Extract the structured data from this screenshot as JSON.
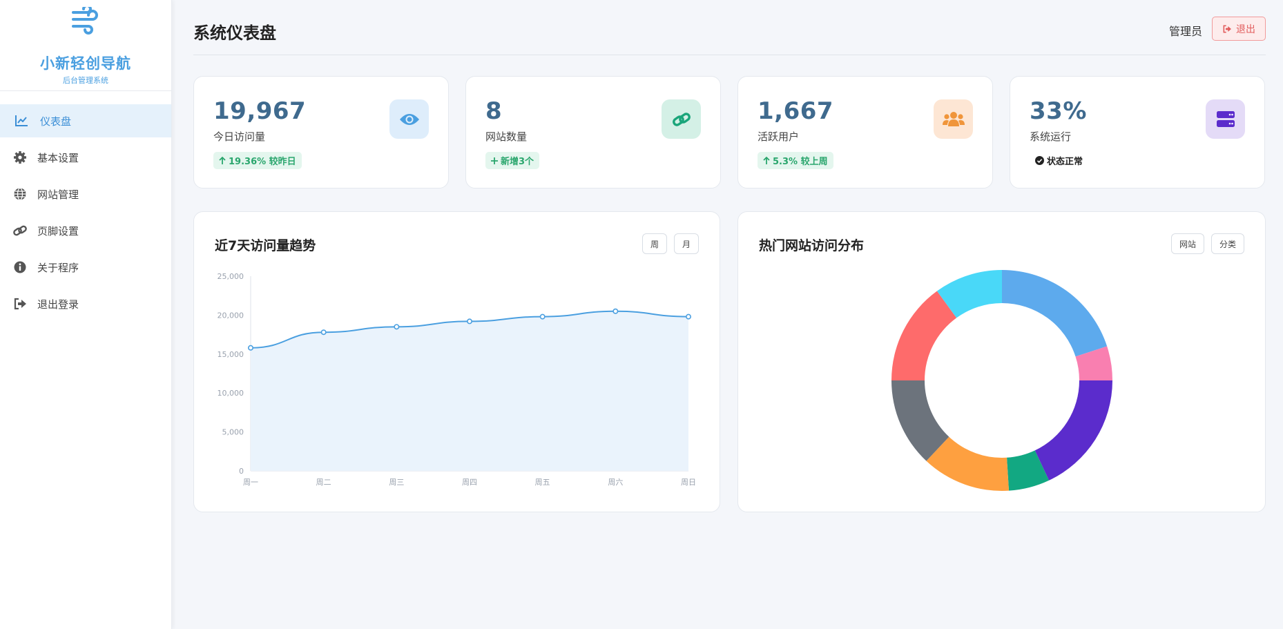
{
  "brand": {
    "title": "小新轻创导航",
    "subtitle": "后台管理系统",
    "logo_icon": "wind-icon",
    "color": "#4a9fe0"
  },
  "sidebar": {
    "items": [
      {
        "label": "仪表盘",
        "icon": "chart-line-icon",
        "active": true
      },
      {
        "label": "基本设置",
        "icon": "gear-icon",
        "active": false
      },
      {
        "label": "网站管理",
        "icon": "globe-icon",
        "active": false
      },
      {
        "label": "页脚设置",
        "icon": "link-icon",
        "active": false
      },
      {
        "label": "关于程序",
        "icon": "info-icon",
        "active": false
      },
      {
        "label": "退出登录",
        "icon": "sign-out-icon",
        "active": false
      }
    ]
  },
  "header": {
    "title": "系统仪表盘",
    "admin": "管理员",
    "logout_label": "退出"
  },
  "stats": [
    {
      "value": "19,967",
      "label": "今日访问量",
      "badge": "19.36% 较昨日",
      "badge_icon": "arrow-up-icon",
      "icon": "eye-icon",
      "icon_color": "#4a9fe0",
      "icon_bg": "#deedfb"
    },
    {
      "value": "8",
      "label": "网站数量",
      "badge": "新增3个",
      "badge_icon": "plus-icon",
      "icon": "link-icon",
      "icon_color": "#1aa57a",
      "icon_bg": "#d4f0e6"
    },
    {
      "value": "1,667",
      "label": "活跃用户",
      "badge": "5.3% 较上周",
      "badge_icon": "arrow-up-icon",
      "icon": "users-icon",
      "icon_color": "#f0953a",
      "icon_bg": "#fde6d4"
    },
    {
      "value": "33%",
      "label": "系统运行",
      "badge": "状态正常",
      "badge_icon": "check-circle-icon",
      "icon": "server-icon",
      "icon_color": "#5b2ccc",
      "icon_bg": "#e4dbf7"
    }
  ],
  "trend_panel": {
    "title": "近7天访问量趋势",
    "buttons": [
      "周",
      "月"
    ]
  },
  "pie_panel": {
    "title": "热门网站访问分布",
    "buttons": [
      "网站",
      "分类"
    ]
  },
  "chart_data": [
    {
      "type": "area",
      "title": "近7天访问量趋势",
      "categories": [
        "周一",
        "周二",
        "周三",
        "周四",
        "周五",
        "周六",
        "周日"
      ],
      "values": [
        15800,
        17800,
        18500,
        19200,
        19800,
        20500,
        19800
      ],
      "ylim": [
        0,
        25000
      ],
      "yticks": [
        "0",
        "5,000",
        "10,000",
        "15,000",
        "20,000",
        "25,000"
      ],
      "color": "#4a9fe0",
      "fill": "#eaf3fc",
      "grid": false
    },
    {
      "type": "pie",
      "donut": true,
      "title": "热门网站访问分布",
      "values": [
        20,
        5,
        18,
        6,
        13,
        13,
        15,
        10
      ],
      "colors": [
        "#5daaed",
        "#f97fb0",
        "#5b2ccc",
        "#12a882",
        "#fea040",
        "#6c737c",
        "#fe6b6b",
        "#49d8f8"
      ]
    }
  ]
}
